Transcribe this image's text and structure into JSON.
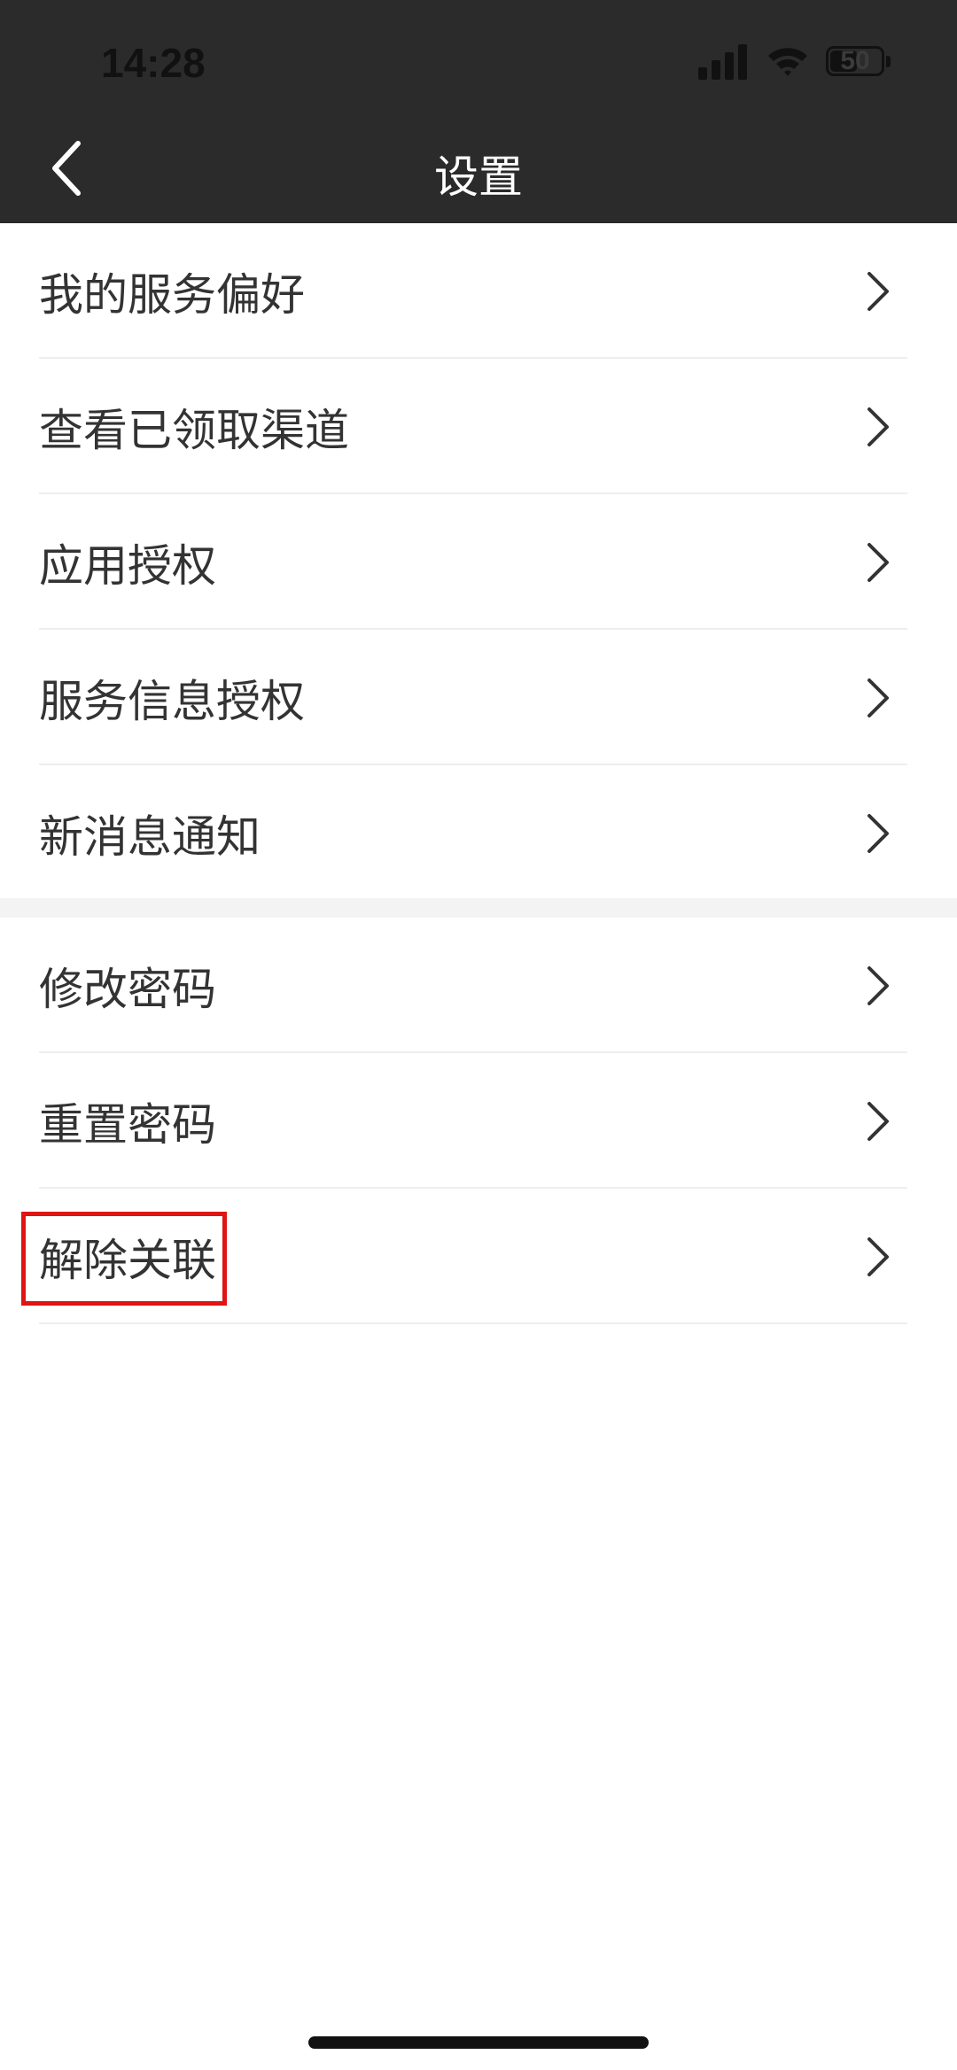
{
  "status_bar": {
    "time": "14:28",
    "battery_level": "50"
  },
  "nav": {
    "title": "设置",
    "back_icon": "chevron-left-icon"
  },
  "section1": {
    "items": [
      {
        "label": "我的服务偏好"
      },
      {
        "label": "查看已领取渠道"
      },
      {
        "label": "应用授权"
      },
      {
        "label": "服务信息授权"
      },
      {
        "label": "新消息通知"
      }
    ]
  },
  "section2": {
    "items": [
      {
        "label": "修改密码"
      },
      {
        "label": "重置密码"
      },
      {
        "label": "解除关联"
      }
    ]
  },
  "colors": {
    "header": "#2b2b2b",
    "highlight": "#e01414"
  }
}
